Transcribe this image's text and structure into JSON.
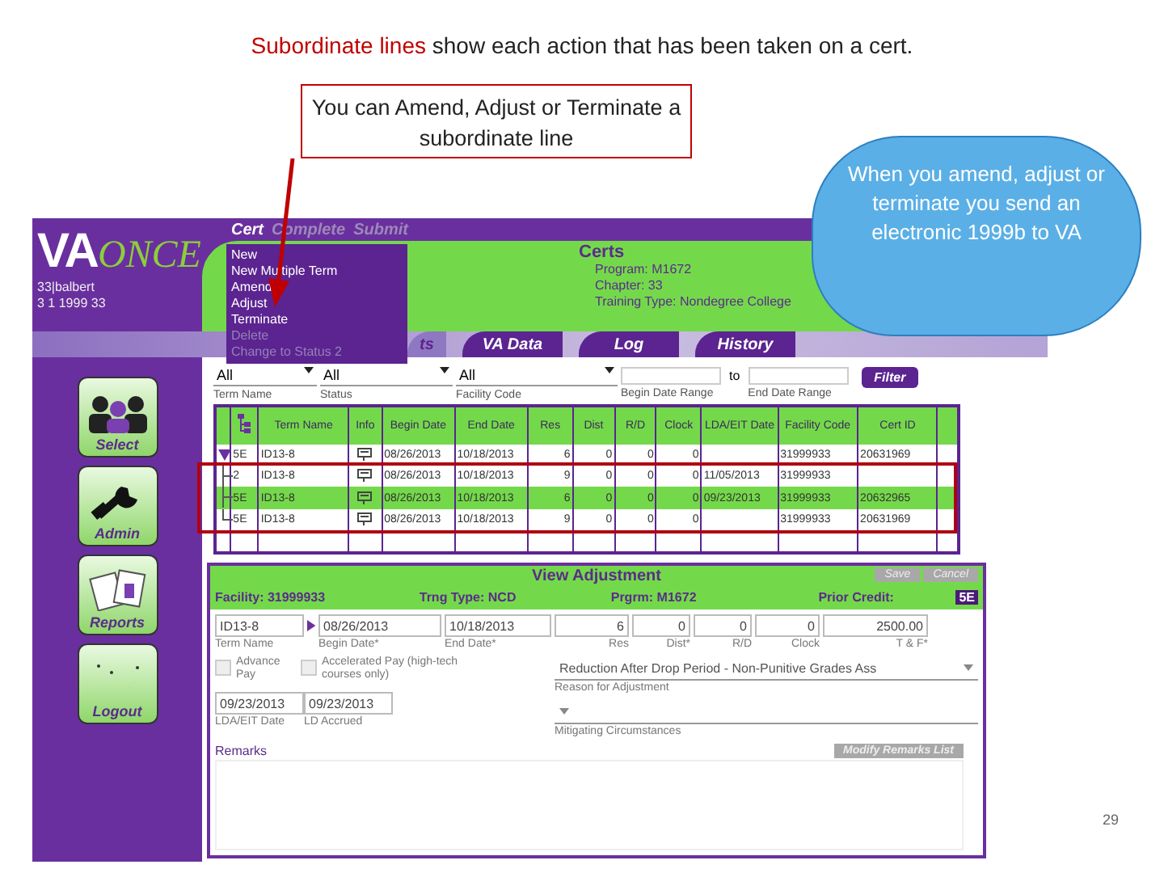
{
  "slide": {
    "caption": {
      "highlight": "Subordinate lines",
      "text": "show each action that has been taken on a cert."
    },
    "callout": "You can Amend, Adjust or Terminate a subordinate line",
    "cloud": "When you amend, adjust or terminate you send an electronic 1999b to VA",
    "page_number": "29"
  },
  "app": {
    "logo": {
      "left": "VA",
      "right": "ONCE"
    },
    "user": [
      "33|balbert",
      "3 1 1999 33"
    ],
    "menubar": [
      {
        "label": "Cert",
        "disabled": false
      },
      {
        "label": "Complete",
        "disabled": true
      },
      {
        "label": "Submit",
        "disabled": true
      }
    ],
    "menu": [
      {
        "label": "New",
        "disabled": false
      },
      {
        "label": "New Multiple Term",
        "disabled": false
      },
      {
        "label": "Amend",
        "disabled": false
      },
      {
        "label": "Adjust",
        "disabled": false
      },
      {
        "label": "Terminate",
        "disabled": false
      },
      {
        "label": "Delete",
        "disabled": true
      },
      {
        "label": "Change to Status 2",
        "disabled": true
      }
    ],
    "header": {
      "title": "Certs",
      "lines": [
        "Program: M1672",
        "Chapter: 33",
        "Training Type: Nondegree College"
      ]
    },
    "tabs": [
      {
        "label": "ts",
        "selected": true
      },
      {
        "label": "VA Data",
        "selected": false
      },
      {
        "label": "Log",
        "selected": false
      },
      {
        "label": "History",
        "selected": false
      }
    ],
    "sidebar": [
      {
        "kind": "select",
        "label": "Select"
      },
      {
        "kind": "admin",
        "label": "Admin"
      },
      {
        "kind": "reports",
        "label": "Reports"
      },
      {
        "kind": "logout",
        "label": "Logout"
      }
    ],
    "filters": {
      "fields": [
        {
          "value": "All",
          "label": "Term Name",
          "kind": "select"
        },
        {
          "value": "All",
          "label": "Status",
          "kind": "select"
        },
        {
          "value": "All",
          "label": "Facility Code",
          "kind": "select"
        },
        {
          "label": "Begin Date Range",
          "kind": "date"
        },
        {
          "label": "End Date Range",
          "kind": "date"
        }
      ],
      "to": "to",
      "button": "Filter"
    },
    "table": {
      "expanded": true,
      "columns": [
        "",
        "Term Name",
        "Info",
        "Begin Date",
        "End Date",
        "Res",
        "Dist",
        "R/D",
        "Clock",
        "LDA/EIT Date",
        "Facility Code",
        "Cert ID"
      ],
      "rows": [
        {
          "kind": "parent",
          "selected": false,
          "cells": [
            "5E",
            "ID13-8",
            "",
            "08/26/2013",
            "10/18/2013",
            "6",
            "0",
            "0",
            "0",
            "",
            "31999933",
            "20631969"
          ]
        },
        {
          "kind": "child",
          "selected": false,
          "cells": [
            "2",
            "ID13-8",
            "",
            "08/26/2013",
            "10/18/2013",
            "9",
            "0",
            "0",
            "0",
            "11/05/2013",
            "31999933",
            ""
          ]
        },
        {
          "kind": "child",
          "selected": true,
          "cells": [
            "5E",
            "ID13-8",
            "",
            "08/26/2013",
            "10/18/2013",
            "6",
            "0",
            "0",
            "0",
            "09/23/2013",
            "31999933",
            "20632965"
          ]
        },
        {
          "kind": "last-child",
          "selected": false,
          "cells": [
            "5E",
            "ID13-8",
            "",
            "08/26/2013",
            "10/18/2013",
            "9",
            "0",
            "0",
            "0",
            "",
            "31999933",
            "20631969"
          ]
        }
      ]
    },
    "panel": {
      "title": "View Adjustment",
      "buttons": [
        "Save",
        "Cancel"
      ],
      "info": [
        "Facility: 31999933",
        "Trng Type: NCD",
        "Prgrm: M1672",
        "Prior Credit:"
      ],
      "badge": "5E",
      "fields": [
        {
          "kind": "text",
          "value": "ID13-8",
          "label": "Term Name"
        },
        {
          "kind": "text",
          "value": "08/26/2013",
          "label": "Begin Date*"
        },
        {
          "kind": "text",
          "value": "10/18/2013",
          "label": "End Date*"
        },
        {
          "kind": "number",
          "value": "6",
          "label": "Res"
        },
        {
          "kind": "number",
          "value": "0",
          "label": "Dist*"
        },
        {
          "kind": "number",
          "value": "0",
          "label": "R/D"
        },
        {
          "kind": "number",
          "value": "0",
          "label": "Clock"
        },
        {
          "kind": "money",
          "value": "2500.00",
          "label": "T & F*"
        }
      ],
      "checkboxes": [
        {
          "label": "Advance Pay",
          "checked": false
        },
        {
          "label": "Accelerated Pay (high-tech courses only)",
          "checked": false
        }
      ],
      "dates": [
        {
          "value": "09/23/2013",
          "label": "LDA/EIT Date"
        },
        {
          "value": "09/23/2013",
          "label": "LD Accrued"
        }
      ],
      "selects": [
        {
          "value": "Reduction After Drop Period - Non-Punitive Grades Ass",
          "label": "Reason for Adjustment"
        },
        {
          "label": "Mitigating Circumstances"
        }
      ],
      "remarks_label": "Remarks",
      "remarks_button": "Modify Remarks List"
    }
  }
}
